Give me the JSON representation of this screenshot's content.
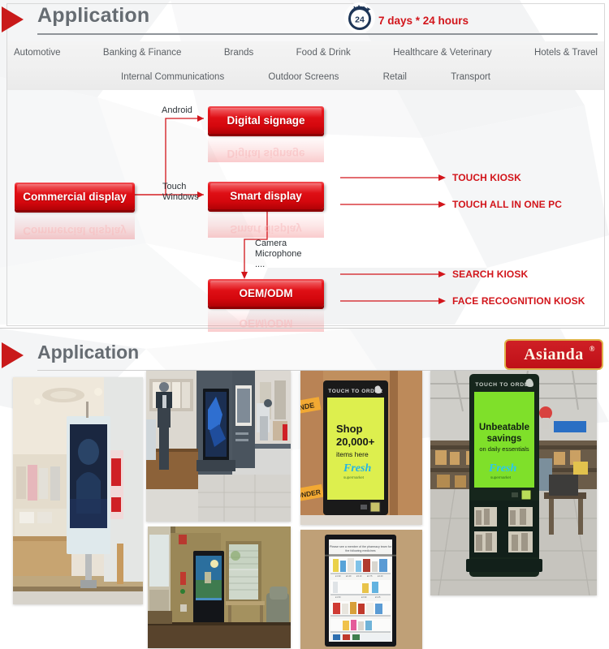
{
  "section1": {
    "header": {
      "title": "Application",
      "badge_number": "24",
      "badge_icon": "clock-24-icon",
      "service_text": "7 days * 24 hours",
      "triangle_icon": "triangle-right-icon"
    },
    "nav": {
      "row1": [
        "Automotive",
        "Banking & Finance",
        "Brands",
        "Food & Drink",
        "Healthcare & Veterinary",
        "Hotels & Travel"
      ],
      "row2": [
        "Internal Communications",
        "Outdoor Screens",
        "Retail",
        "Transport"
      ]
    },
    "diagram": {
      "boxes": [
        {
          "id": "commercial-display",
          "label": "Commercial display"
        },
        {
          "id": "digital-signage",
          "label": "Digital signage"
        },
        {
          "id": "smart-display",
          "label": "Smart display"
        },
        {
          "id": "oem-odm",
          "label": "OEM/ODM"
        }
      ],
      "connectors": [
        {
          "id": "android",
          "label": "Android"
        },
        {
          "id": "touch-windows",
          "label": "Touch\nWindows"
        },
        {
          "id": "camera-microphone",
          "label": "Camera\nMicrophone\n...."
        }
      ],
      "outputs": [
        {
          "id": "touch-kiosk",
          "label": "TOUCH KIOSK"
        },
        {
          "id": "touch-all-in-one-pc",
          "label": "TOUCH ALL IN ONE PC"
        },
        {
          "id": "search-kiosk",
          "label": "SEARCH KIOSK"
        },
        {
          "id": "face-recognition-kiosk",
          "label": "FACE RECOGNITION KIOSK"
        }
      ]
    }
  },
  "section2": {
    "header": {
      "title": "Application",
      "triangle_icon": "triangle-right-icon"
    },
    "logo": {
      "brand": "Asianda",
      "trademark": "®"
    },
    "photos": [
      {
        "id": "photo-retail-clothing-store-kiosk",
        "caption": "Freestanding digital signage kiosk in clothing retail store"
      },
      {
        "id": "photo-menswear-store-display",
        "caption": "Digital display column in menswear department store"
      },
      {
        "id": "photo-fresh-shop-20000-kiosk",
        "caption": "Wall-mounted self-order kiosk",
        "screen_lines": [
          "TOUCH TO ORDER",
          "Shop",
          "20,000+",
          "items here",
          "Fresh",
          "supermarket"
        ]
      },
      {
        "id": "photo-fresh-unbeatable-savings-kiosk",
        "caption": "Floor-standing self-order kiosk in supermarket",
        "screen_lines": [
          "TOUCH TO ORDER",
          "Unbeatable",
          "savings",
          "on daily essentials",
          "Fresh",
          "supermarket"
        ]
      },
      {
        "id": "photo-lobby-totem-display",
        "caption": "Totem display in office lobby beside window"
      },
      {
        "id": "photo-pharmacy-product-board",
        "caption": "Wall-mounted vertical product listing display"
      }
    ]
  },
  "colors": {
    "brand_red": "#d2151b",
    "box_red": "#e8161c",
    "heading_gray": "#666c72",
    "nav_bg": "#efefef",
    "logo_gold": "#e0b24a"
  }
}
